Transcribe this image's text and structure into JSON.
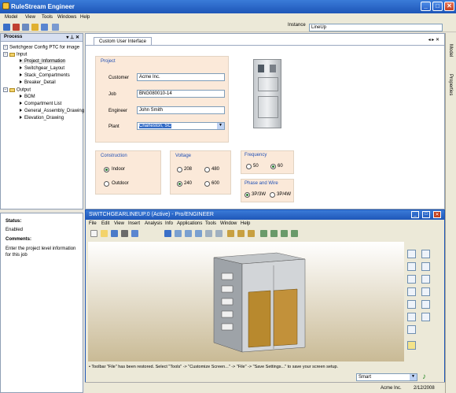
{
  "window": {
    "title": "RuleStream Engineer"
  },
  "menu": [
    "Model",
    "View",
    "Tools",
    "Windows",
    "Help"
  ],
  "instance": {
    "label": "Instance",
    "value": "LineUp"
  },
  "process": {
    "title": "Process",
    "pin": "▾ ⊥ ✕",
    "items": [
      {
        "label": "Switchgear Config PTC for image",
        "level": 0,
        "kind": "root"
      },
      {
        "label": "Input",
        "level": 1,
        "kind": "folder"
      },
      {
        "label": "Project_Information",
        "level": 2,
        "kind": "item"
      },
      {
        "label": "Switchgear_Layout",
        "level": 2,
        "kind": "item"
      },
      {
        "label": "Stack_Compartments",
        "level": 2,
        "kind": "item"
      },
      {
        "label": "Breaker_Detail",
        "level": 2,
        "kind": "item"
      },
      {
        "label": "Output",
        "level": 1,
        "kind": "folder"
      },
      {
        "label": "BOM",
        "level": 2,
        "kind": "item"
      },
      {
        "label": "Compartment List",
        "level": 2,
        "kind": "item"
      },
      {
        "label": "General_Assembly_Drawing",
        "level": 2,
        "kind": "item"
      },
      {
        "label": "Elevation_Drawing",
        "level": 2,
        "kind": "item"
      }
    ]
  },
  "status": {
    "heading": "Status:",
    "value": "Enabled",
    "comments_heading": "Comments:",
    "comment": "Enter the project level information for this job"
  },
  "tab": {
    "label": "Custom User Interface"
  },
  "project": {
    "title": "Project",
    "customer_label": "Customer",
    "customer": "Acme Inc.",
    "job_label": "Job",
    "job": "BNG080010-14",
    "engineer_label": "Engineer",
    "engineer": "John Smith",
    "plant_label": "Plant",
    "plant": "Charleston, SC"
  },
  "construction": {
    "title": "Construction",
    "options": [
      "Indoor",
      "Outdoor"
    ],
    "selected": "Indoor"
  },
  "voltage": {
    "title": "Voltage",
    "options": [
      "208",
      "480",
      "240",
      "600"
    ],
    "selected": "240"
  },
  "frequency": {
    "title": "Frequency",
    "options": [
      "50",
      "60"
    ],
    "selected": "60"
  },
  "phase": {
    "title": "Phase and Wire",
    "options": [
      "3P/3W",
      "3P/4W"
    ],
    "selected": "3P/3W"
  },
  "proe": {
    "title": "SWITCHGEARLINEUP.0 (Active) - Pro/ENGINEER",
    "menu": [
      "File",
      "Edit",
      "View",
      "Insert",
      "Analysis",
      "Info",
      "Applications",
      "Tools",
      "Window",
      "Help"
    ],
    "message": "Toolbar \"File\" has been restored.  Select \"Tools\" -> \"Customize Screen...\" -> \"File\" -> \"Save Settings...\" to save your screen setup.",
    "filter": "Smart"
  },
  "side": {
    "model": "Model",
    "properties": "Properties"
  },
  "footer": {
    "company": "Acme Inc.",
    "date": "2/12/2008"
  }
}
